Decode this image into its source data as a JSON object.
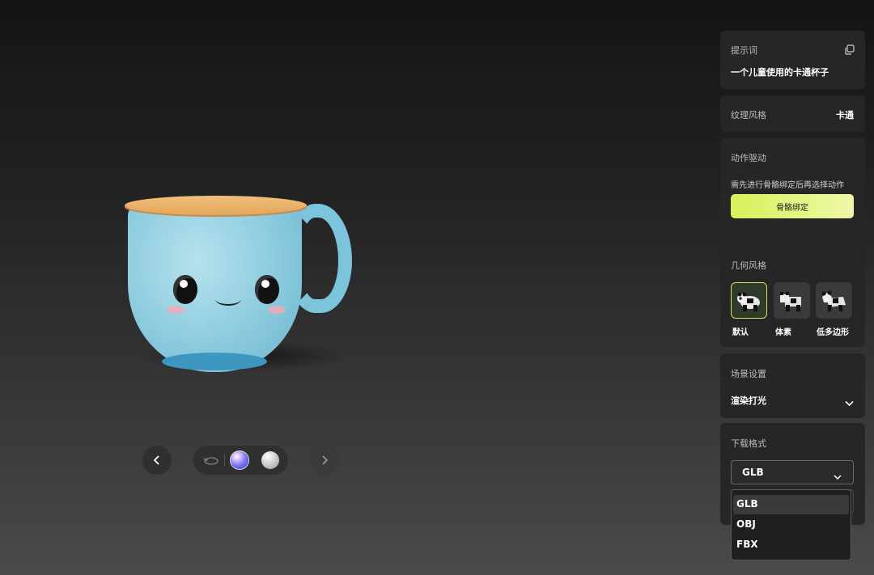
{
  "prompt_panel": {
    "title": "提示词",
    "value": "一个儿童使用的卡通杯子",
    "copy_icon": "copy-icon"
  },
  "texture_panel": {
    "title": "纹理风格",
    "value": "卡通"
  },
  "motion_panel": {
    "title": "动作驱动",
    "note": "需先进行骨骼绑定后再选择动作",
    "button_label": "骨骼绑定",
    "accent": "#d6f25a"
  },
  "geometry_panel": {
    "title": "几何风格",
    "options": [
      {
        "label": "默认",
        "selected": true
      },
      {
        "label": "体素",
        "selected": false
      },
      {
        "label": "低多边形",
        "selected": false
      }
    ]
  },
  "scene_panel": {
    "title": "场景设置",
    "value": "渲染打光"
  },
  "download_panel": {
    "title": "下载格式",
    "selected": "GLB",
    "options": [
      "GLB",
      "OBJ",
      "FBX"
    ]
  },
  "viewer": {
    "cup_colors": {
      "body": "#92cfe1",
      "rim": "#e2a65a"
    }
  }
}
